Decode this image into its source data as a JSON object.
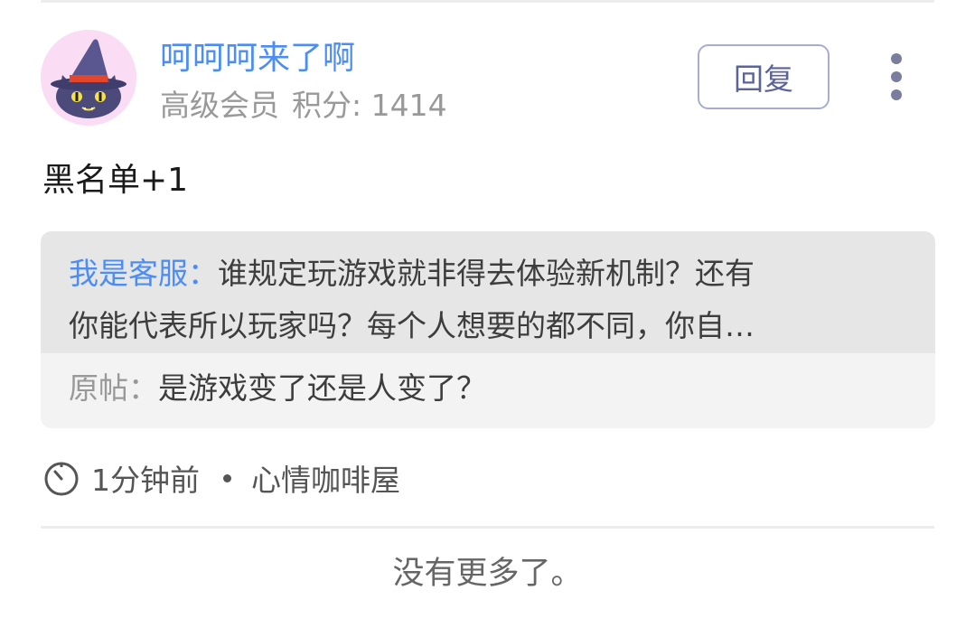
{
  "post": {
    "username": "呵呵呵来了啊",
    "member_level": "高级会员",
    "points": "积分: 1414",
    "reply_label": "回复",
    "content": "黑名单+1",
    "quote": {
      "author": "我是客服：",
      "line1": "谁规定玩游戏就非得去体验新机制？还有",
      "line2": "你能代表所以玩家吗？每个人想要的都不同，你自…",
      "orig_label": "原帖：",
      "orig_title": "是游戏变了还是人变了？"
    },
    "time": "1分钟前",
    "forum": "心情咖啡屋"
  },
  "footer": {
    "no_more": "没有更多了。"
  },
  "colors": {
    "accent_blue": "#4c8df5",
    "reply_border": "#a7acd4",
    "avatar_bg": "#fadcf5"
  },
  "icons": {
    "avatar": "witch-cat-avatar-icon",
    "more": "more-vertical-icon",
    "clock": "clock-icon"
  }
}
